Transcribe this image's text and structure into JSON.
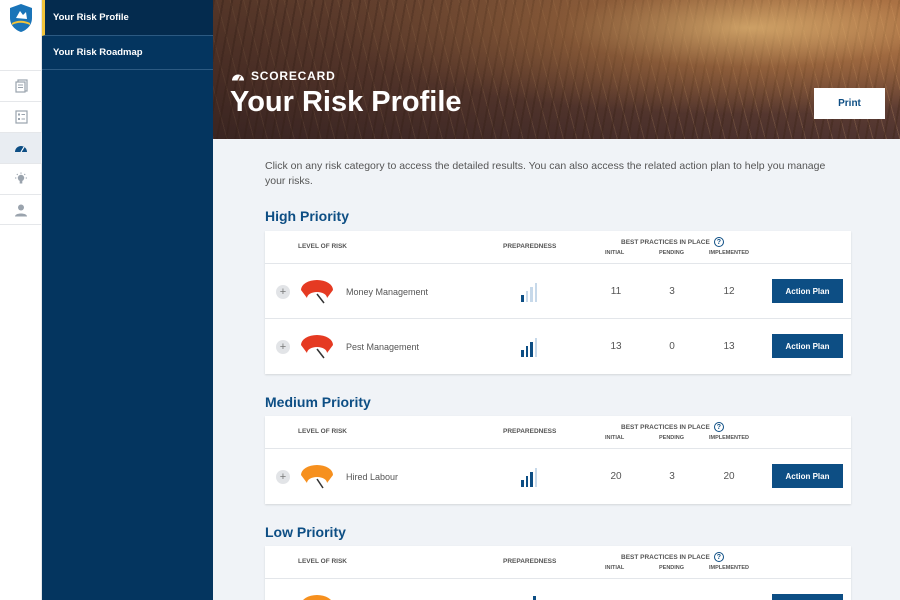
{
  "rail": {
    "items": [
      {
        "icon": "document-icon"
      },
      {
        "icon": "checklist-icon"
      },
      {
        "icon": "gauge-icon"
      },
      {
        "icon": "lightbulb-icon"
      },
      {
        "icon": "person-icon"
      }
    ]
  },
  "nav": {
    "items": [
      {
        "label": "Your Risk Profile"
      },
      {
        "label": "Your Risk Roadmap"
      }
    ]
  },
  "hero": {
    "eyebrow": "SCORECARD",
    "title": "Your Risk Profile",
    "print_label": "Print"
  },
  "intro": "Click on any risk category to access the detailed results. You can also access the related action plan to help you manage your risks.",
  "table_headers": {
    "level_of_risk": "LEVEL OF RISK",
    "preparedness": "PREPAREDNESS",
    "best_practices": "BEST PRACTICES IN PLACE",
    "help": "?",
    "initial": "INITIAL",
    "pending": "PENDING",
    "implemented": "IMPLEMENTED"
  },
  "colors": {
    "brand_navy": "#04355f",
    "accent_blue": "#0d4e84",
    "high_risk": "#e53a22",
    "medium_risk": "#f6901e"
  },
  "sections": [
    {
      "title": "High Priority",
      "rows": [
        {
          "name": "Money Management",
          "expand": "+",
          "initial": "11",
          "pending": "3",
          "implemented": "12",
          "action": "Action Plan",
          "preparedness_level": 1
        },
        {
          "name": "Pest Management",
          "expand": "+",
          "initial": "13",
          "pending": "0",
          "implemented": "13",
          "action": "Action Plan",
          "preparedness_level": 3
        }
      ]
    },
    {
      "title": "Medium Priority",
      "rows": [
        {
          "name": "Hired Labour",
          "expand": "+",
          "initial": "20",
          "pending": "3",
          "implemented": "20",
          "action": "Action Plan",
          "preparedness_level": 3
        }
      ]
    },
    {
      "title": "Low Priority",
      "rows": []
    }
  ]
}
